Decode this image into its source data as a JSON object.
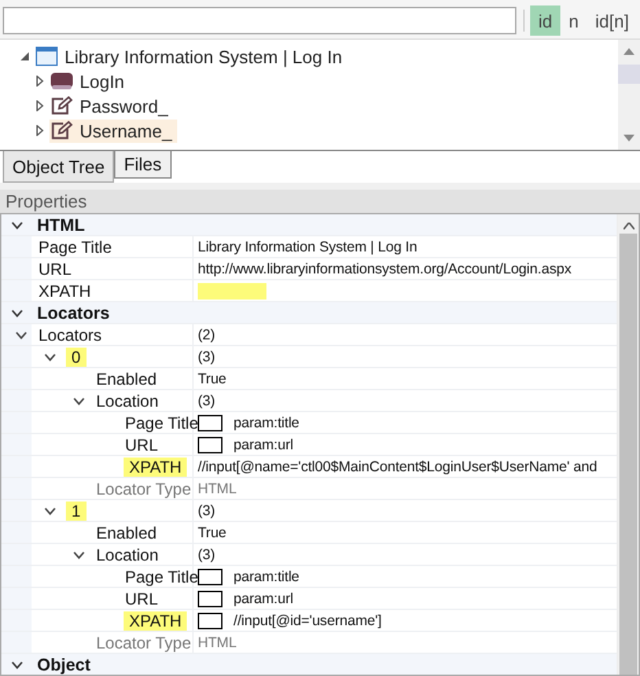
{
  "toggles": [
    {
      "label": "id",
      "selected": true
    },
    {
      "label": "n",
      "selected": false
    },
    {
      "label": "id[n]",
      "selected": false
    }
  ],
  "tree": [
    {
      "label": "Library Information System | Log In",
      "kind": "page",
      "expanded": true,
      "selected": false,
      "children": [
        {
          "label": "LogIn",
          "kind": "button",
          "expanded": false,
          "selected": false
        },
        {
          "label": "Password_",
          "kind": "textbox",
          "expanded": false,
          "selected": false
        },
        {
          "label": "Username_",
          "kind": "textbox",
          "expanded": false,
          "selected": true
        }
      ]
    }
  ],
  "tabs": [
    {
      "label": "Object Tree",
      "selected": true
    },
    {
      "label": "Files",
      "selected": false
    }
  ],
  "properties_title": "Properties",
  "properties": [
    {
      "kind": "category",
      "label": "HTML",
      "expanded": true,
      "children": [
        {
          "kind": "property",
          "label": "Page Title",
          "value": "Library Information System | Log In",
          "highlighted": false,
          "disabled": false,
          "boxed": false
        },
        {
          "kind": "property",
          "label": "URL",
          "value": "http://www.libraryinformationsystem.org/Account/Login.aspx",
          "highlighted": false,
          "disabled": false,
          "boxed": false
        },
        {
          "kind": "property",
          "label": "XPATH",
          "highlighted": false,
          "value_highlighted": true,
          "disabled": false,
          "boxed": false
        }
      ]
    },
    {
      "kind": "category",
      "label": "Locators",
      "expanded": true,
      "children": [
        {
          "kind": "property",
          "label": "Locators",
          "value": "(2)",
          "expanded": true,
          "highlighted": false,
          "disabled": false,
          "boxed": false,
          "children": [
            {
              "kind": "property",
              "label": "0",
              "value": "(3)",
              "expanded": true,
              "highlighted": true,
              "disabled": false,
              "boxed": false,
              "children": [
                {
                  "kind": "property",
                  "label": "Enabled",
                  "value": "True",
                  "highlighted": false,
                  "disabled": false,
                  "boxed": false
                },
                {
                  "kind": "property",
                  "label": "Location",
                  "value": "(3)",
                  "expanded": true,
                  "highlighted": false,
                  "disabled": false,
                  "boxed": false,
                  "children": [
                    {
                      "kind": "property",
                      "label": "Page Title",
                      "value": "param:title",
                      "highlighted": false,
                      "disabled": false,
                      "boxed": true
                    },
                    {
                      "kind": "property",
                      "label": "URL",
                      "value": "param:url",
                      "highlighted": false,
                      "disabled": false,
                      "boxed": true
                    },
                    {
                      "kind": "property",
                      "label": "XPATH",
                      "value": "//input[@name='ctl00$MainContent$LoginUser$UserName' and",
                      "highlighted": true,
                      "disabled": false,
                      "boxed": false
                    }
                  ]
                },
                {
                  "kind": "property",
                  "label": "Locator Type",
                  "value": "HTML",
                  "highlighted": false,
                  "disabled": true,
                  "boxed": false
                }
              ]
            },
            {
              "kind": "property",
              "label": "1",
              "value": "(3)",
              "expanded": true,
              "highlighted": true,
              "disabled": false,
              "boxed": false,
              "children": [
                {
                  "kind": "property",
                  "label": "Enabled",
                  "value": "True",
                  "highlighted": false,
                  "disabled": false,
                  "boxed": false
                },
                {
                  "kind": "property",
                  "label": "Location",
                  "value": "(3)",
                  "expanded": true,
                  "highlighted": false,
                  "disabled": false,
                  "boxed": false,
                  "children": [
                    {
                      "kind": "property",
                      "label": "Page Title",
                      "value": "param:title",
                      "highlighted": false,
                      "disabled": false,
                      "boxed": true
                    },
                    {
                      "kind": "property",
                      "label": "URL",
                      "value": "param:url",
                      "highlighted": false,
                      "disabled": false,
                      "boxed": true
                    },
                    {
                      "kind": "property",
                      "label": "XPATH",
                      "value": "//input[@id='username']",
                      "highlighted": true,
                      "disabled": false,
                      "boxed": true
                    }
                  ]
                },
                {
                  "kind": "property",
                  "label": "Locator Type",
                  "value": "HTML",
                  "highlighted": false,
                  "disabled": true,
                  "boxed": false
                }
              ]
            }
          ]
        }
      ]
    },
    {
      "kind": "category",
      "label": "Object",
      "expanded": true
    }
  ]
}
